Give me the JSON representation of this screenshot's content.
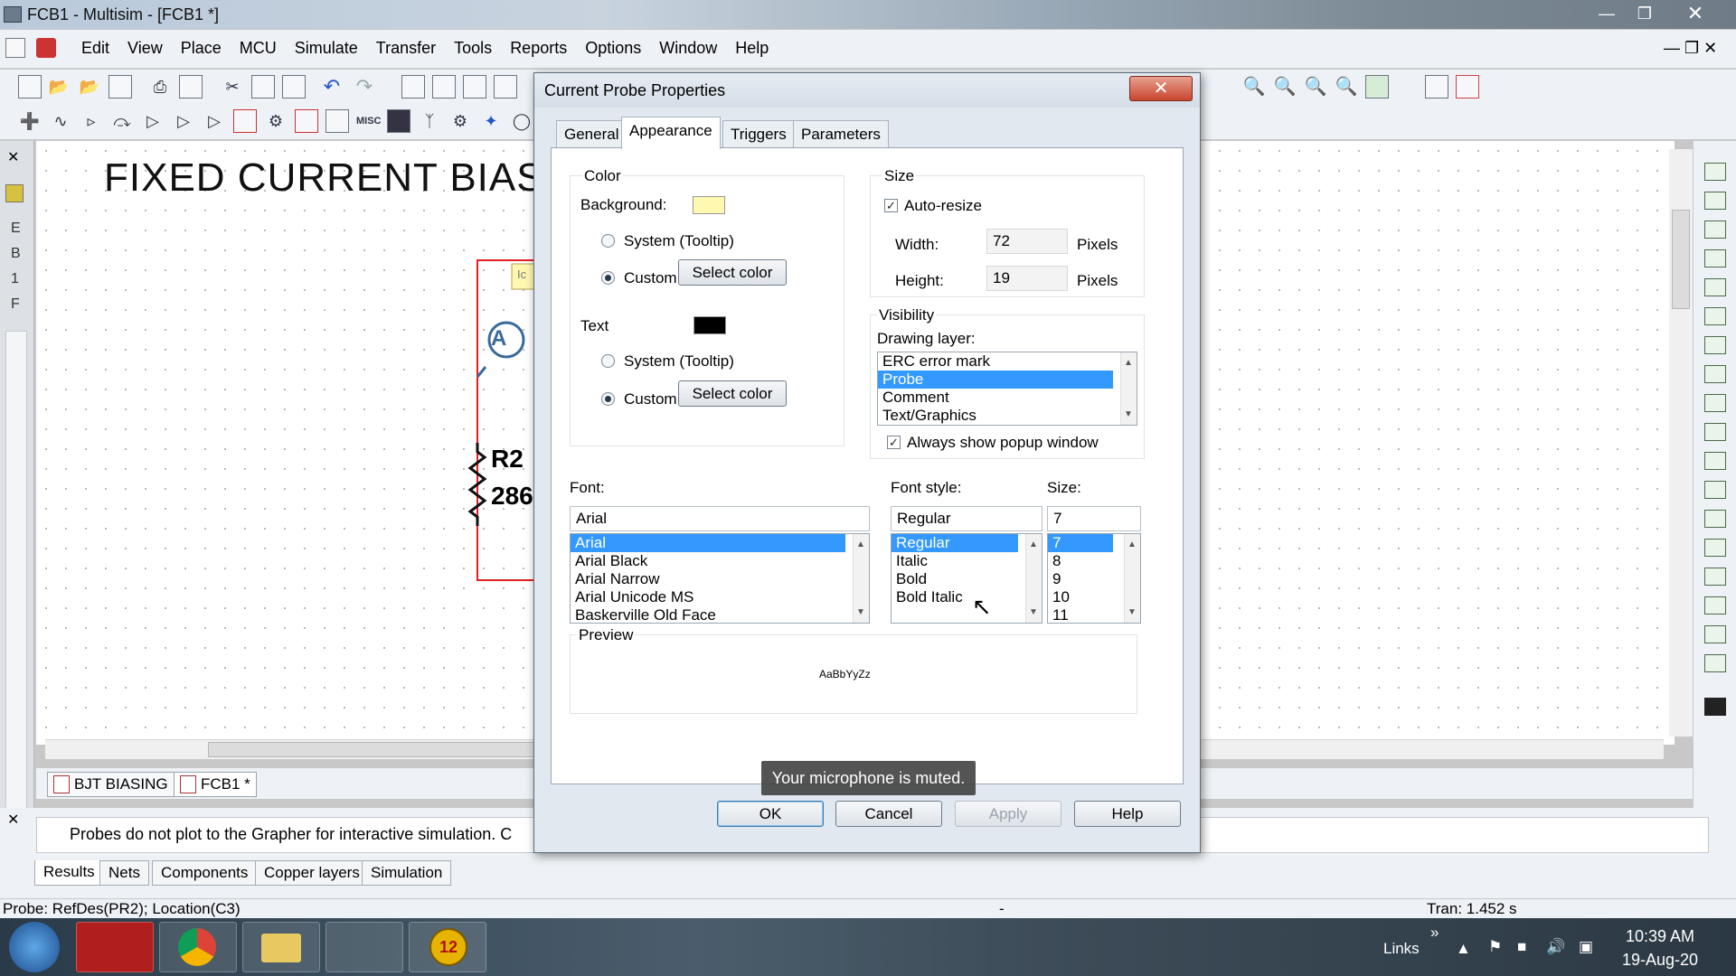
{
  "window": {
    "title": "FCB1 - Multisim - [FCB1 *]"
  },
  "menubar": {
    "items": [
      "Edit",
      "View",
      "Place",
      "MCU",
      "Simulate",
      "Transfer",
      "Tools",
      "Reports",
      "Options",
      "Window",
      "Help"
    ]
  },
  "schematic": {
    "title": "FIXED CURRENT BIAS",
    "probe_tag": "Ic",
    "ammeter": "A",
    "resistor_ref": "R2",
    "resistor_value": "286"
  },
  "left_panel": {
    "letters": [
      "E",
      "B",
      "1",
      "F"
    ]
  },
  "doc_tabs": [
    "BJT BIASING",
    "FCB1 *"
  ],
  "spreadsheet": {
    "message": "Probes do not plot to the Grapher for interactive simulation. C",
    "tabs": [
      "Results",
      "Nets",
      "Components",
      "Copper layers",
      "Simulation"
    ]
  },
  "statusbar": {
    "left": "Probe: RefDes(PR2); Location(C3)",
    "middle": "-",
    "right": "Tran: 1.452 s"
  },
  "taskbar": {
    "links_label": "Links",
    "chevron": "»",
    "time": "10:39 AM",
    "date": "19-Aug-20",
    "multisim_badge": "12"
  },
  "dialog": {
    "title": "Current Probe Properties",
    "close_glyph": "✕",
    "tabs": [
      "General",
      "Appearance",
      "Triggers",
      "Parameters"
    ],
    "active_tab": "Appearance",
    "color": {
      "group_label": "Color",
      "background_label": "Background:",
      "background_color": "#fff8b0",
      "bg_system_label": "System (Tooltip)",
      "bg_custom_label": "Custom",
      "select_color_label": "Select color",
      "text_label": "Text",
      "text_color": "#000000",
      "text_system_label": "System (Tooltip)",
      "text_custom_label": "Custom"
    },
    "size": {
      "group_label": "Size",
      "auto_resize_label": "Auto-resize",
      "auto_resize_checked": true,
      "width_label": "Width:",
      "width_value": "72",
      "width_unit": "Pixels",
      "height_label": "Height:",
      "height_value": "19",
      "height_unit": "Pixels"
    },
    "visibility": {
      "group_label": "Visibility",
      "drawing_layer_label": "Drawing layer:",
      "layers": [
        "ERC error mark",
        "Probe",
        "Comment",
        "Text/Graphics"
      ],
      "selected_layer": "Probe",
      "always_show_label": "Always show popup window",
      "always_show_checked": true
    },
    "font": {
      "font_label": "Font:",
      "font_value": "Arial",
      "fonts": [
        "Arial",
        "Arial Black",
        "Arial Narrow",
        "Arial Unicode MS",
        "Baskerville Old Face"
      ],
      "style_label": "Font style:",
      "style_value": "Regular",
      "styles": [
        "Regular",
        "Italic",
        "Bold",
        "Bold Italic"
      ],
      "size_label": "Size:",
      "size_value": "7",
      "sizes": [
        "7",
        "8",
        "9",
        "10",
        "11"
      ]
    },
    "preview": {
      "label": "Preview",
      "sample": "AaBbYyZz"
    },
    "buttons": {
      "ok": "OK",
      "cancel": "Cancel",
      "apply": "Apply",
      "help": "Help"
    }
  },
  "toast": "Your microphone is muted.",
  "colors": {
    "accent_selection": "#3399ff",
    "schematic_wire": "#e02020",
    "close_button": "#c9452d"
  }
}
